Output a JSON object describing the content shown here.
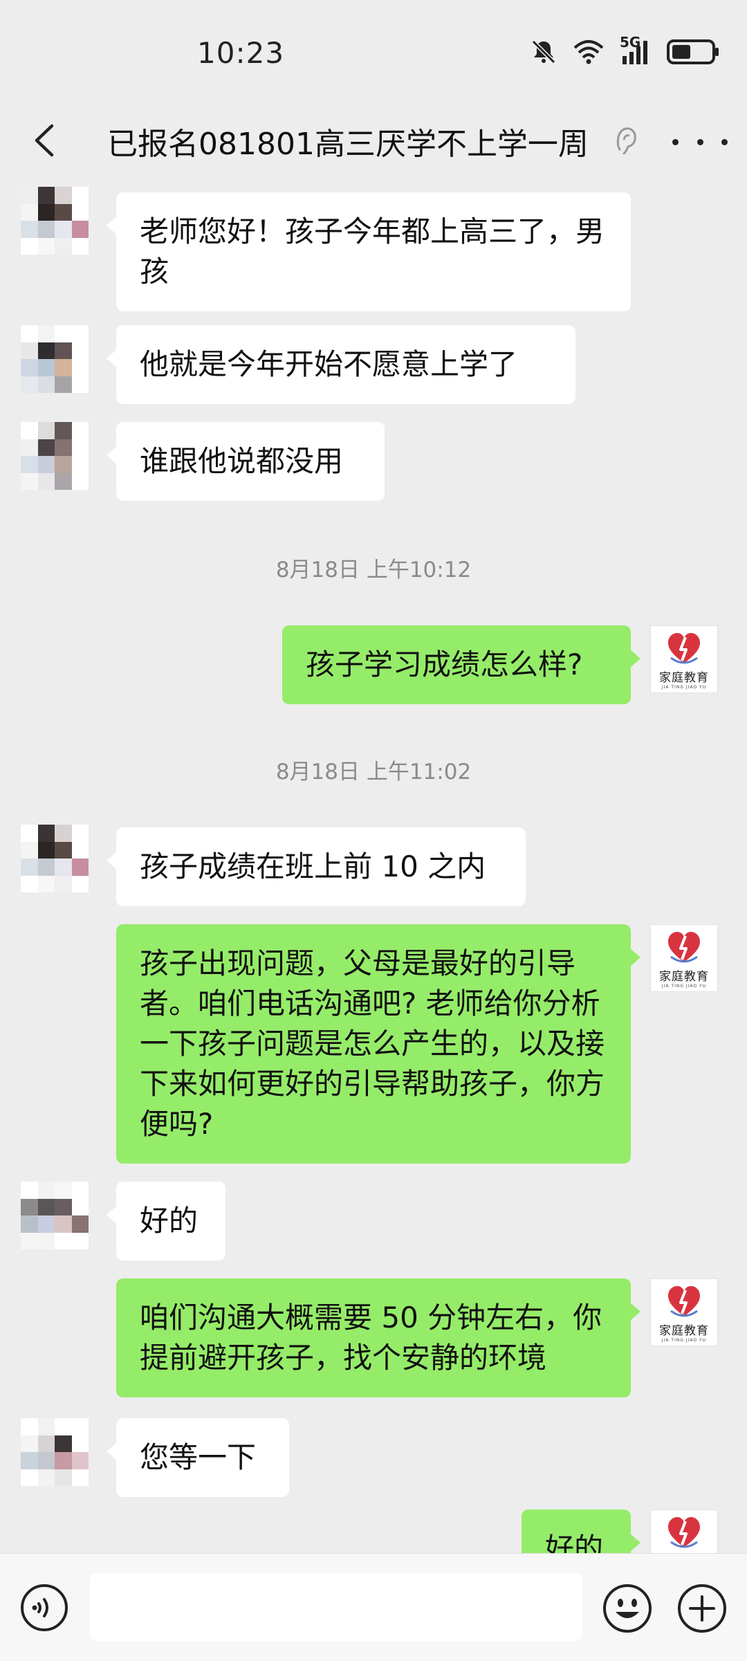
{
  "status_bar": {
    "time": "10:23",
    "network": "5G",
    "icons": [
      "mute-bell-icon",
      "wifi-icon",
      "signal-icon",
      "battery-icon"
    ]
  },
  "header": {
    "title": "已报名081801高三厌学不上学一周",
    "icons": [
      "back-icon",
      "ear-icon",
      "more-icon"
    ]
  },
  "messages": [
    {
      "side": "left",
      "text": "老师您好！孩子今年都上高三了，男孩"
    },
    {
      "side": "left",
      "text": "他就是今年开始不愿意上学了"
    },
    {
      "side": "left",
      "text": "谁跟他说都没用"
    },
    {
      "timestamp": "8月18日 上午10:12"
    },
    {
      "side": "right",
      "text": "孩子学习成绩怎么样?"
    },
    {
      "timestamp": "8月18日 上午11:02"
    },
    {
      "side": "left",
      "text": "孩子成绩在班上前 10 之内"
    },
    {
      "side": "right",
      "text": "孩子出现问题，父母是最好的引导者。咱们电话沟通吧? 老师给你分析一下孩子问题是怎么产生的，以及接下来如何更好的引导帮助孩子，你方便吗?"
    },
    {
      "side": "left",
      "text": "好的"
    },
    {
      "side": "right",
      "text": "咱们沟通大概需要 50 分钟左右，你提前避开孩子，找个安静的环境"
    },
    {
      "side": "left",
      "text": "您等一下"
    },
    {
      "side": "right",
      "text": "好的"
    }
  ],
  "brand_avatar": {
    "name": "家庭教育",
    "subtitle": "JIA TING JIAO YU"
  },
  "input_bar": {
    "placeholder": "",
    "icons": [
      "voice-icon",
      "emoji-icon",
      "plus-icon"
    ]
  },
  "colors": {
    "background": "#EDEDED",
    "bubble_self": "#95EC69",
    "bubble_other": "#FFFFFF",
    "brand_red": "#D8343F"
  }
}
